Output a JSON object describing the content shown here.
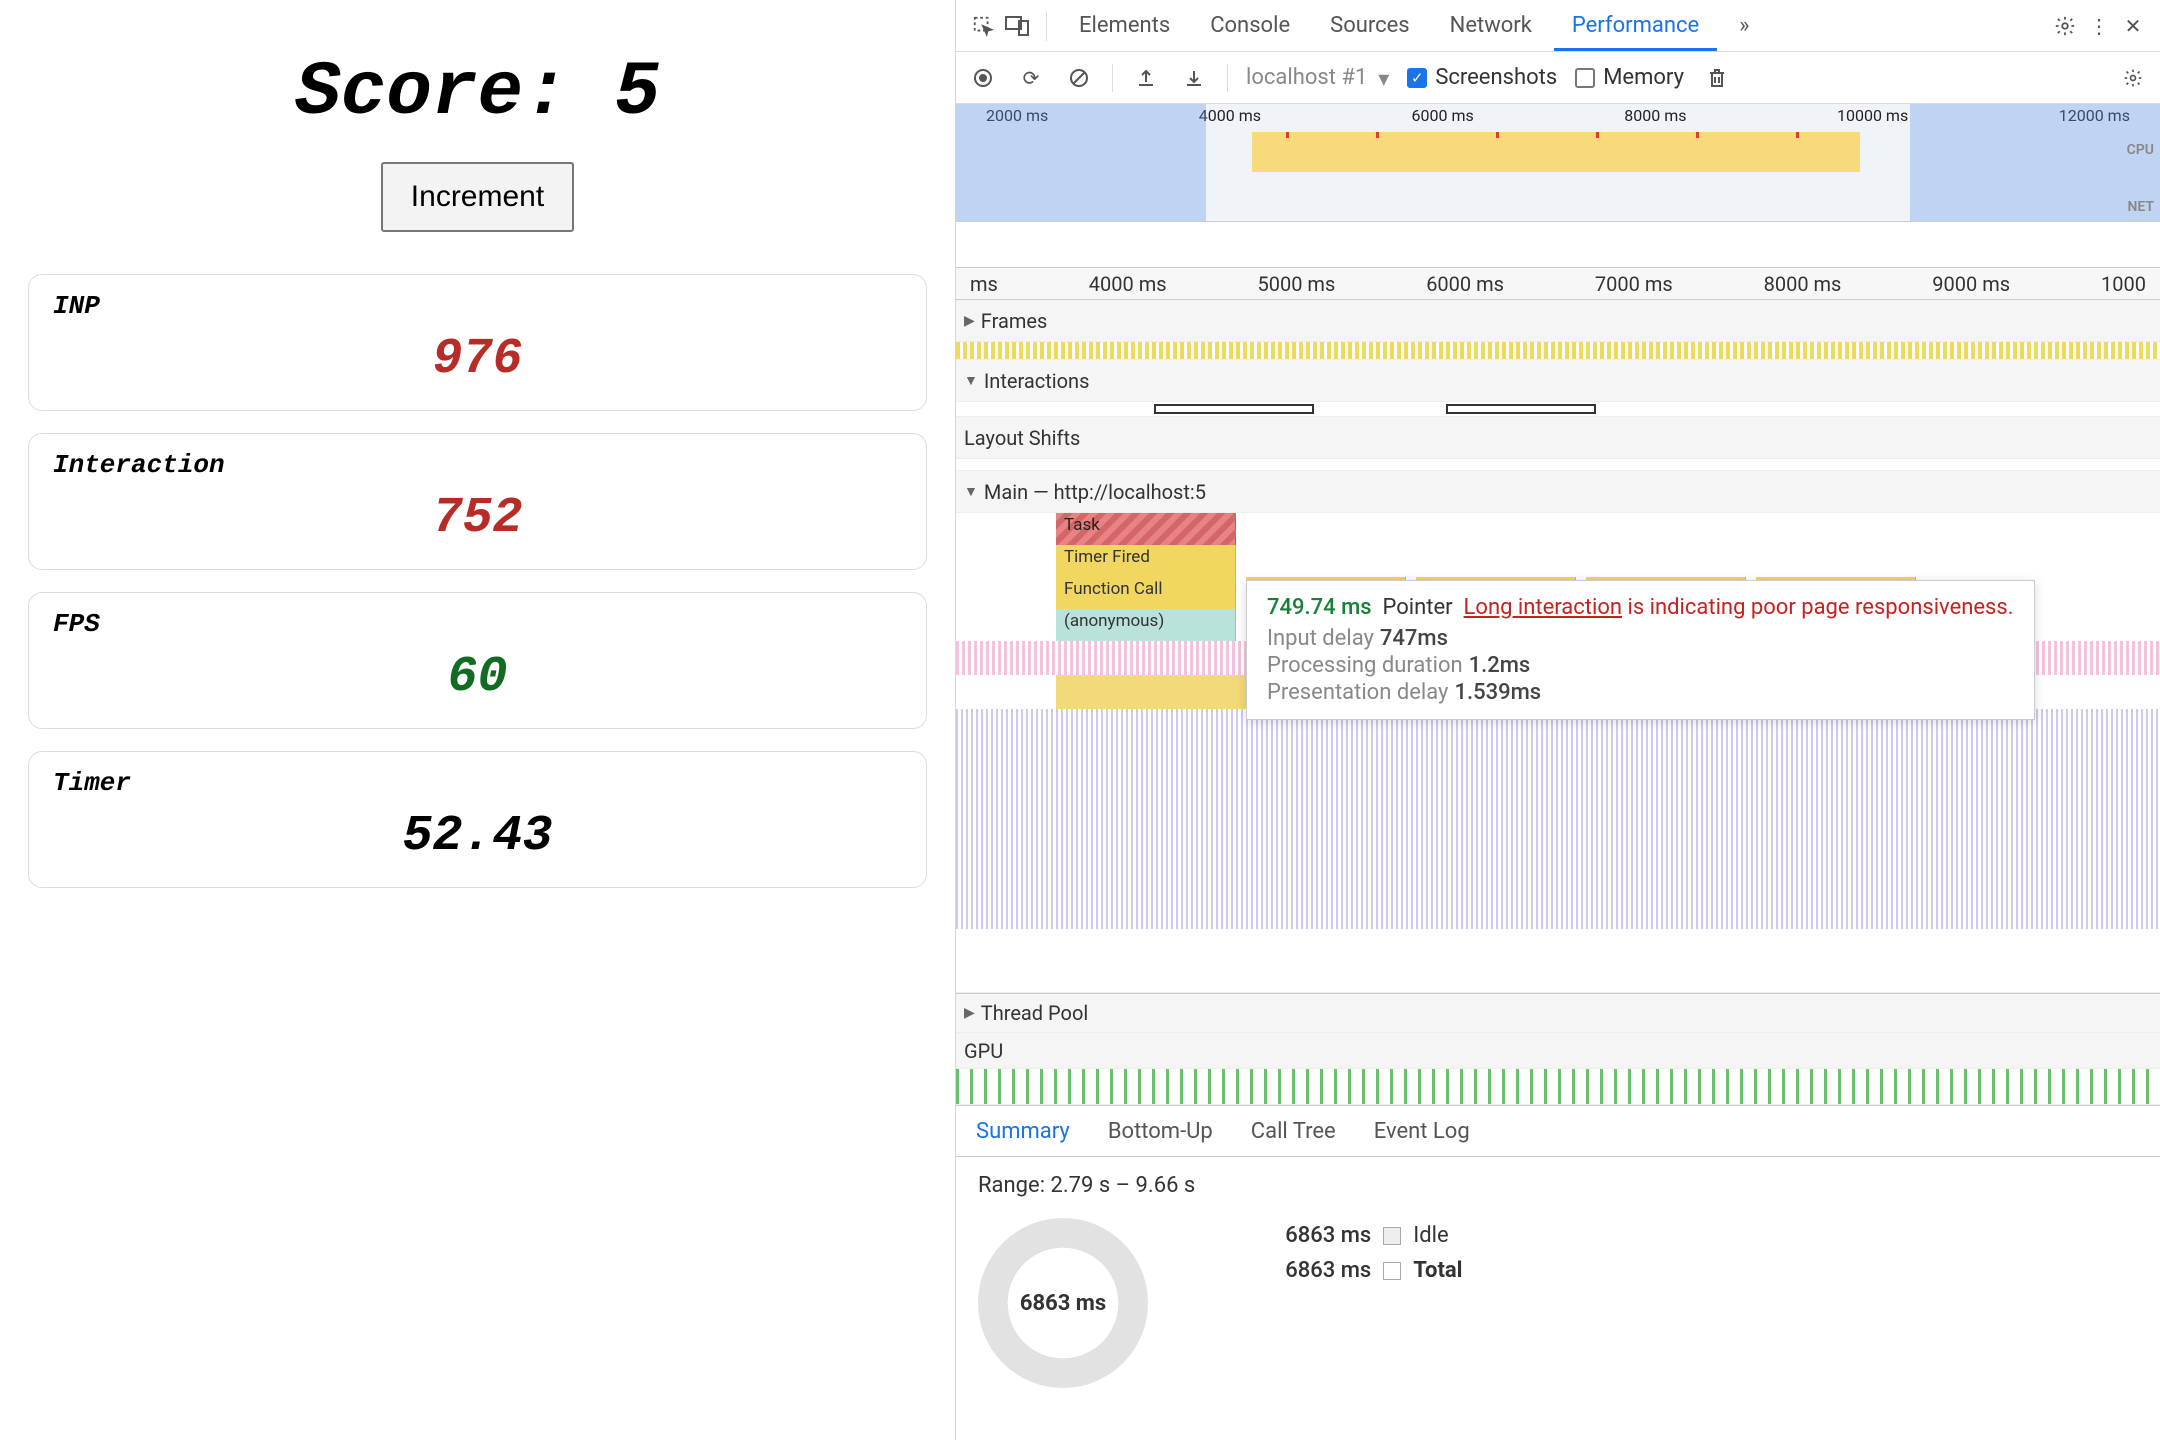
{
  "app": {
    "score_label": "Score: 5",
    "increment_label": "Increment",
    "cards": {
      "inp": {
        "label": "INP",
        "value": "976",
        "class": "red"
      },
      "inter": {
        "label": "Interaction",
        "value": "752",
        "class": "red"
      },
      "fps": {
        "label": "FPS",
        "value": "60",
        "class": "green"
      },
      "timer": {
        "label": "Timer",
        "value": "52.43",
        "class": ""
      }
    }
  },
  "devtools": {
    "tabs": [
      "Elements",
      "Console",
      "Sources",
      "Network",
      "Performance"
    ],
    "tabs_active": "Performance",
    "more_tabs": "»",
    "rec": {
      "profile": "localhost #1",
      "screenshots_label": "Screenshots",
      "memory_label": "Memory",
      "screenshots_checked": true,
      "memory_checked": false
    },
    "overview_ticks": [
      "2000 ms",
      "4000 ms",
      "6000 ms",
      "8000 ms",
      "10000 ms",
      "12000 ms"
    ],
    "overview_right": {
      "cpu": "CPU",
      "net": "NET"
    },
    "ruler_ticks": [
      "ms",
      "4000 ms",
      "5000 ms",
      "6000 ms",
      "7000 ms",
      "8000 ms",
      "9000 ms",
      "1000"
    ],
    "tracks": {
      "frames": "Frames",
      "interactions": "Interactions",
      "layout_shifts": "Layout Shifts",
      "main": "Main — http://localhost:5",
      "thread_pool": "Thread Pool",
      "gpu": "GPU"
    },
    "flame": {
      "task": "Task",
      "timer_fired": "Timer Fired",
      "function_call": "Function Call",
      "anonymous": "(anonymous)"
    },
    "tooltip": {
      "duration": "749.74 ms",
      "type": "Pointer",
      "link": "Long interaction",
      "msg": " is indicating poor page responsiveness.",
      "rows": [
        {
          "k": "Input delay",
          "v": "747ms"
        },
        {
          "k": "Processing duration",
          "v": "1.2ms"
        },
        {
          "k": "Presentation delay",
          "v": "1.539ms"
        }
      ]
    },
    "bottom_tabs": [
      "Summary",
      "Bottom-Up",
      "Call Tree",
      "Event Log"
    ],
    "bottom_active": "Summary",
    "summary": {
      "range": "Range: 2.79 s – 9.66 s",
      "donut": "6863 ms",
      "legend": [
        {
          "ms": "6863 ms",
          "label": "Idle",
          "bold": false
        },
        {
          "ms": "6863 ms",
          "label": "Total",
          "bold": true
        }
      ]
    }
  }
}
